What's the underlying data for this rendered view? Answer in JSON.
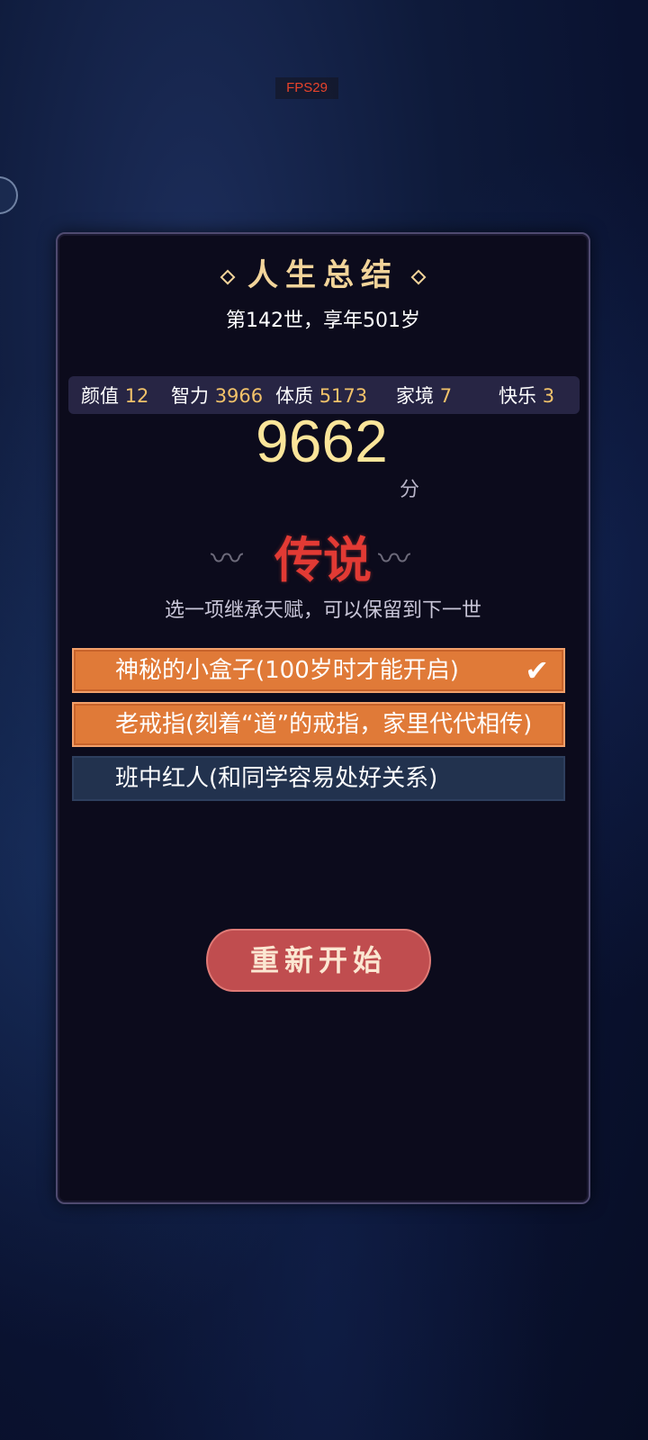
{
  "fps_label": "FPS29",
  "summary": {
    "title": "人生总结",
    "subtitle": "第142世，享年501岁"
  },
  "stats": [
    {
      "label": "颜值",
      "value": "12"
    },
    {
      "label": "智力",
      "value": "3966"
    },
    {
      "label": "体质",
      "value": "5173"
    },
    {
      "label": "家境",
      "value": "7"
    },
    {
      "label": "快乐",
      "value": "3"
    }
  ],
  "score": {
    "value": "9662",
    "unit": "分"
  },
  "rank": "传说",
  "hint": "选一项继承天赋，可以保留到下一世",
  "options": [
    {
      "label": "神秘的小盒子(100岁时才能开启)",
      "state": "selected",
      "checked": true
    },
    {
      "label": "老戒指(刻着“道”的戒指，家里代代相传)",
      "state": "selected",
      "checked": false
    },
    {
      "label": "班中红人(和同学容易处好关系)",
      "state": "normal",
      "checked": false
    }
  ],
  "restart_label": "重新开始",
  "icons": {
    "check": "checkmark-icon",
    "cloud_left": "cloud-ornament-icon",
    "cloud_right": "cloud-ornament-icon"
  },
  "colors": {
    "gold": "#f2d49a",
    "rank_red": "#e23a34",
    "selected": "#e07a38",
    "normal": "#22324e",
    "button": "#c04d4f"
  }
}
